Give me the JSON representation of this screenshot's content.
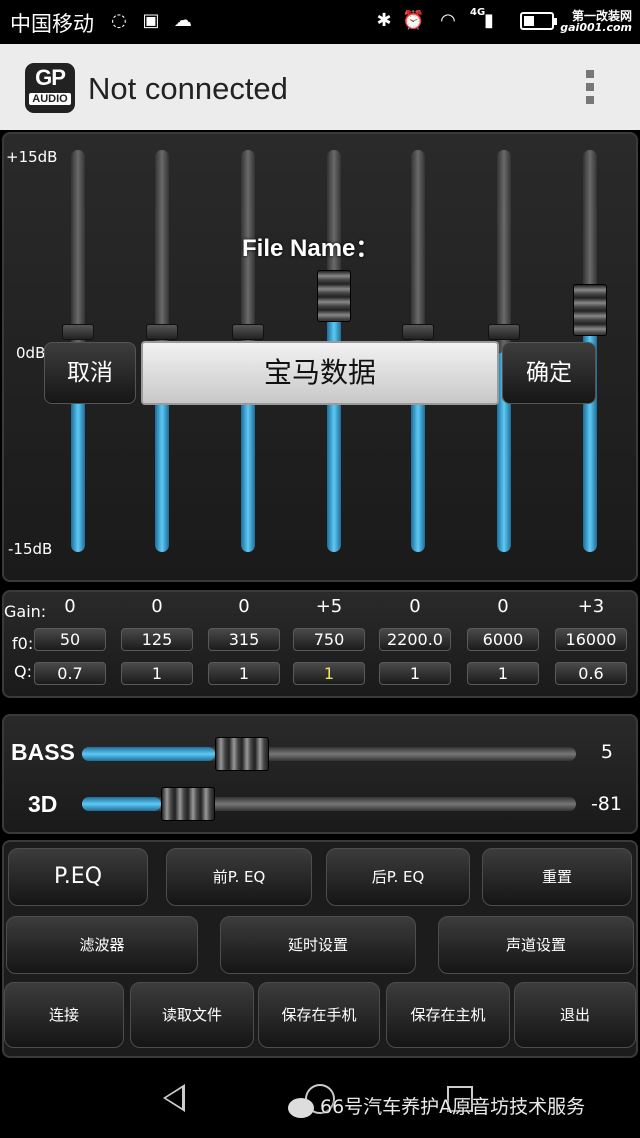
{
  "status_bar": {
    "carrier": "中国移动",
    "network": "4G",
    "watermark_line1": "第一改装网",
    "watermark_line2": "gai001.com"
  },
  "app_bar": {
    "logo_top": "GP",
    "logo_bottom": "AUDIO",
    "title": "Not connected"
  },
  "eq": {
    "axis_top": "+15dB",
    "axis_mid": "0dB",
    "axis_bottom": "-15dB",
    "range_db": [
      -15,
      15
    ],
    "bands": [
      {
        "gain": 0
      },
      {
        "gain": 0
      },
      {
        "gain": 0
      },
      {
        "gain": 5
      },
      {
        "gain": 0
      },
      {
        "gain": 0
      },
      {
        "gain": 3
      }
    ]
  },
  "dialog": {
    "title": "File Name：",
    "value": "宝马数据",
    "cancel": "取消",
    "ok": "确定"
  },
  "params": {
    "gain_label": "Gain:",
    "f0_label": "f0:",
    "q_label": "Q:",
    "gains": [
      "0",
      "0",
      "0",
      "+5",
      "0",
      "0",
      "+3"
    ],
    "f0": [
      "50",
      "125",
      "315",
      "750",
      "2200.0",
      "6000",
      "16000"
    ],
    "q": [
      "0.7",
      "1",
      "1",
      "1",
      "1",
      "1",
      "0.6"
    ]
  },
  "bass": {
    "label": "BASS",
    "value": "5",
    "level": 0.27
  },
  "three_d": {
    "label": "3D",
    "value": "-81",
    "level": 0.16
  },
  "buttons": {
    "row1": [
      "P.EQ",
      "前P. EQ",
      "后P. EQ",
      "重置"
    ],
    "row2": [
      "滤波器",
      "延时设置",
      "声道设置"
    ],
    "row3": [
      "连接",
      "读取文件",
      "保存在手机",
      "保存在主机",
      "退出"
    ]
  },
  "footer_watermark": "66号汽车养护A原音坊技术服务"
}
